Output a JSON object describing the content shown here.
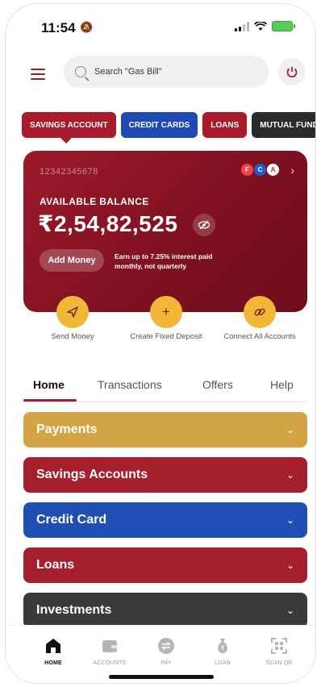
{
  "status_bar": {
    "time": "11:54"
  },
  "search": {
    "placeholder": "Search \"Gas Bill\""
  },
  "product_tabs": [
    {
      "label": "SAVINGS ACCOUNT",
      "selected": true
    },
    {
      "label": "CREDIT CARDS"
    },
    {
      "label": "LOANS"
    },
    {
      "label": "MUTUAL FUND"
    }
  ],
  "balance_card": {
    "account_number": "12342345678",
    "balance_label": "AVAILABLE BALANCE",
    "balance_amount": "₹2,54,82,525",
    "add_money_label": "Add Money",
    "interest_note": "Earn up to 7.25% interest paid monthly, not quarterly"
  },
  "quick_actions": [
    {
      "label": "Send Money",
      "icon": "send-icon"
    },
    {
      "label": "Create Fixed Deposit",
      "icon": "plus-icon"
    },
    {
      "label": "Connect All Accounts",
      "icon": "link-icon"
    }
  ],
  "section_tabs": [
    {
      "label": "Home",
      "selected": true
    },
    {
      "label": "Transactions"
    },
    {
      "label": "Offers"
    },
    {
      "label": "Help"
    }
  ],
  "accordions": [
    {
      "label": "Payments",
      "color": "#d3a444"
    },
    {
      "label": "Savings Accounts",
      "color": "#a51f2d"
    },
    {
      "label": "Credit Card",
      "color": "#1f4fb5"
    },
    {
      "label": "Loans",
      "color": "#a51f2d"
    },
    {
      "label": "Investments",
      "color": "#3a3a3a"
    }
  ],
  "bottom_nav": [
    {
      "label": "HOME",
      "icon": "home-icon",
      "selected": true
    },
    {
      "label": "ACCOUNTS",
      "icon": "wallet-icon"
    },
    {
      "label": "PAY",
      "icon": "transfer-icon"
    },
    {
      "label": "LOAN",
      "icon": "money-bag-icon"
    },
    {
      "label": "SCAN QR",
      "icon": "qr-scan-icon"
    }
  ],
  "colors": {
    "brand_red": "#a81c2b",
    "accent_yellow": "#f3b738",
    "brand_blue": "#1f49b3"
  }
}
